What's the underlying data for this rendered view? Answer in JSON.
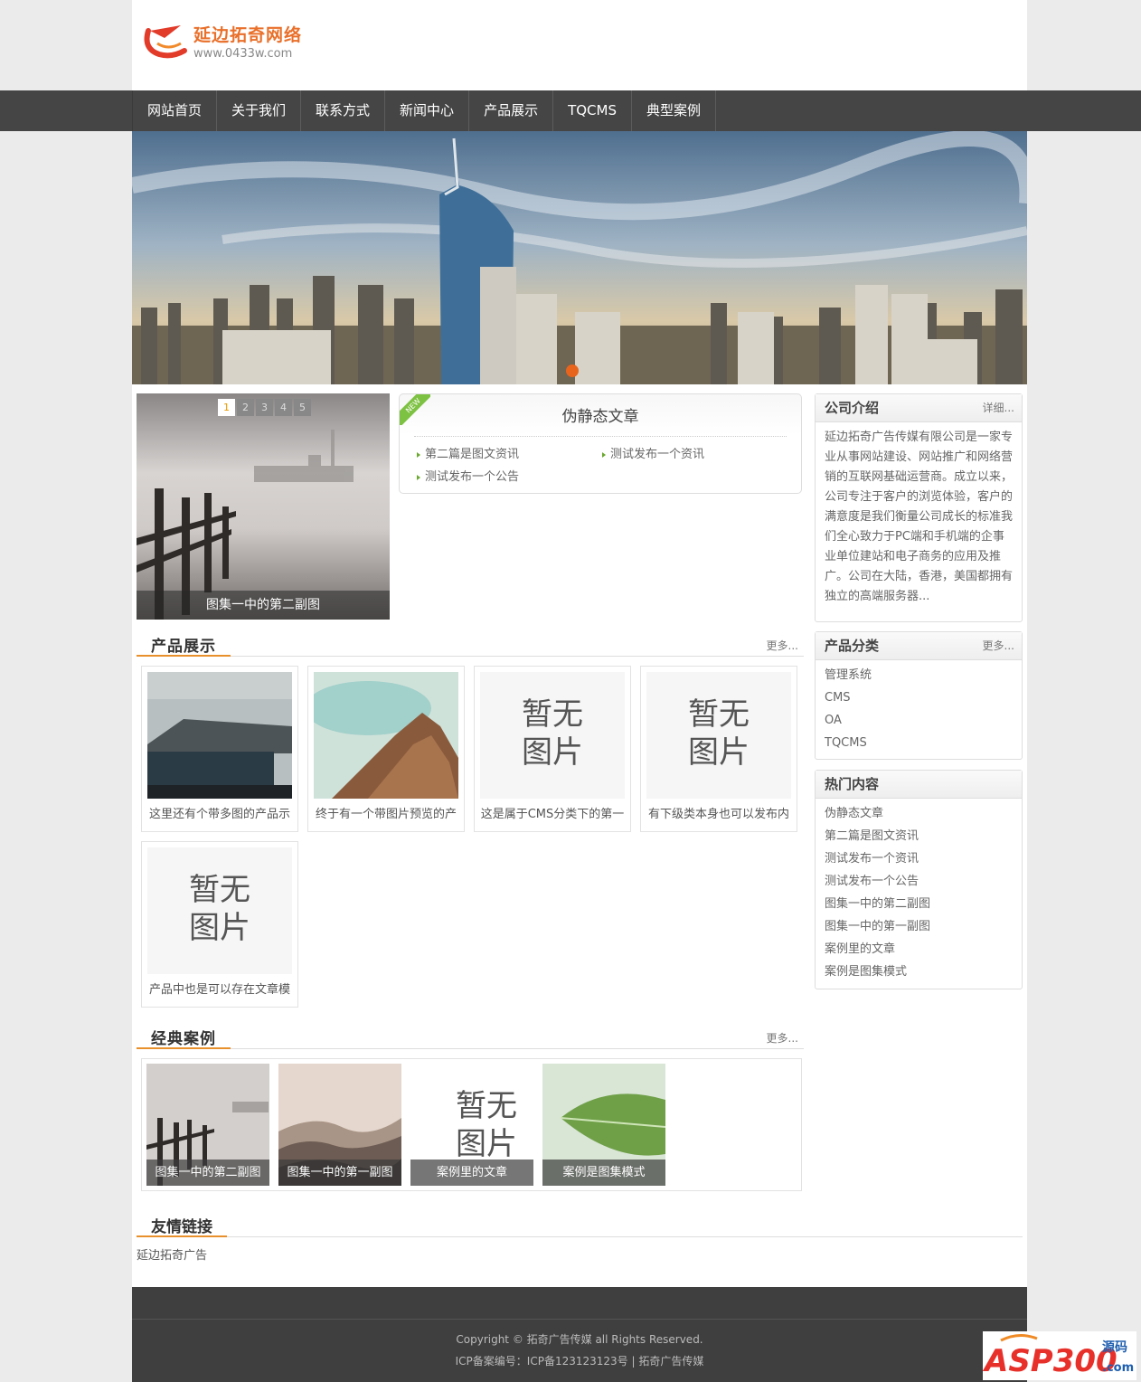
{
  "logo": {
    "title": "延边拓奇网络",
    "url": "www.0433w.com"
  },
  "nav": [
    "网站首页",
    "关于我们",
    "联系方式",
    "新闻中心",
    "产品展示",
    "TQCMS",
    "典型案例"
  ],
  "slideshow": {
    "pages": [
      "1",
      "2",
      "3",
      "4",
      "5"
    ],
    "active_page": "1",
    "caption": "图集一中的第二副图"
  },
  "newsbox": {
    "badge": "NEW",
    "title": "伪静态文章",
    "items": [
      "第二篇是图文资讯",
      "测试发布一个资讯",
      "测试发布一个公告"
    ]
  },
  "products": {
    "title": "产品展示",
    "more": "更多...",
    "no_image_text": [
      "暂无",
      "图片"
    ],
    "items": [
      "这里还有个带多图的产品示",
      "终于有一个带图片预览的产",
      "这是属于CMS分类下的第一",
      "有下级类本身也可以发布内",
      "产品中也是可以存在文章模"
    ]
  },
  "cases": {
    "title": "经典案例",
    "more": "更多...",
    "items": [
      "图集一中的第二副图",
      "图集一中的第一副图",
      "案例里的文章",
      "案例是图集模式"
    ]
  },
  "links": {
    "title": "友情链接",
    "items": [
      "延边拓奇广告"
    ]
  },
  "sidebar": {
    "about": {
      "title": "公司介绍",
      "more": "详细...",
      "text": "延边拓奇广告传媒有限公司是一家专业从事网站建设、网站推广和网络营销的互联网基础运营商。成立以来，公司专注于客户的浏览体验，客户的满意度是我们衡量公司成长的标准我们全心致力于PC端和手机端的企事业单位建站和电子商务的应用及推广。公司在大陆，香港，美国都拥有独立的高端服务器..."
    },
    "categories": {
      "title": "产品分类",
      "more": "更多...",
      "items": [
        "管理系统",
        "CMS",
        "OA",
        "TQCMS"
      ]
    },
    "hot": {
      "title": "热门内容",
      "items": [
        "伪静态文章",
        "第二篇是图文资讯",
        "测试发布一个资讯",
        "测试发布一个公告",
        "图集一中的第二副图",
        "图集一中的第一副图",
        "案例里的文章",
        "案例是图集模式"
      ]
    }
  },
  "footer": {
    "copyright": "Copyright © 拓奇广告传媒 all Rights Reserved.",
    "icp": "ICP备案编号：ICP备123123123号 | 拓奇广告传媒"
  },
  "watermark": {
    "text": "ASP300",
    "sub": "源码",
    "domain": ".com"
  },
  "colors": {
    "accent": "#e8902b",
    "nav_bg": "#454545",
    "logo_orange": "#e9702b",
    "news_green": "#7ec243"
  }
}
